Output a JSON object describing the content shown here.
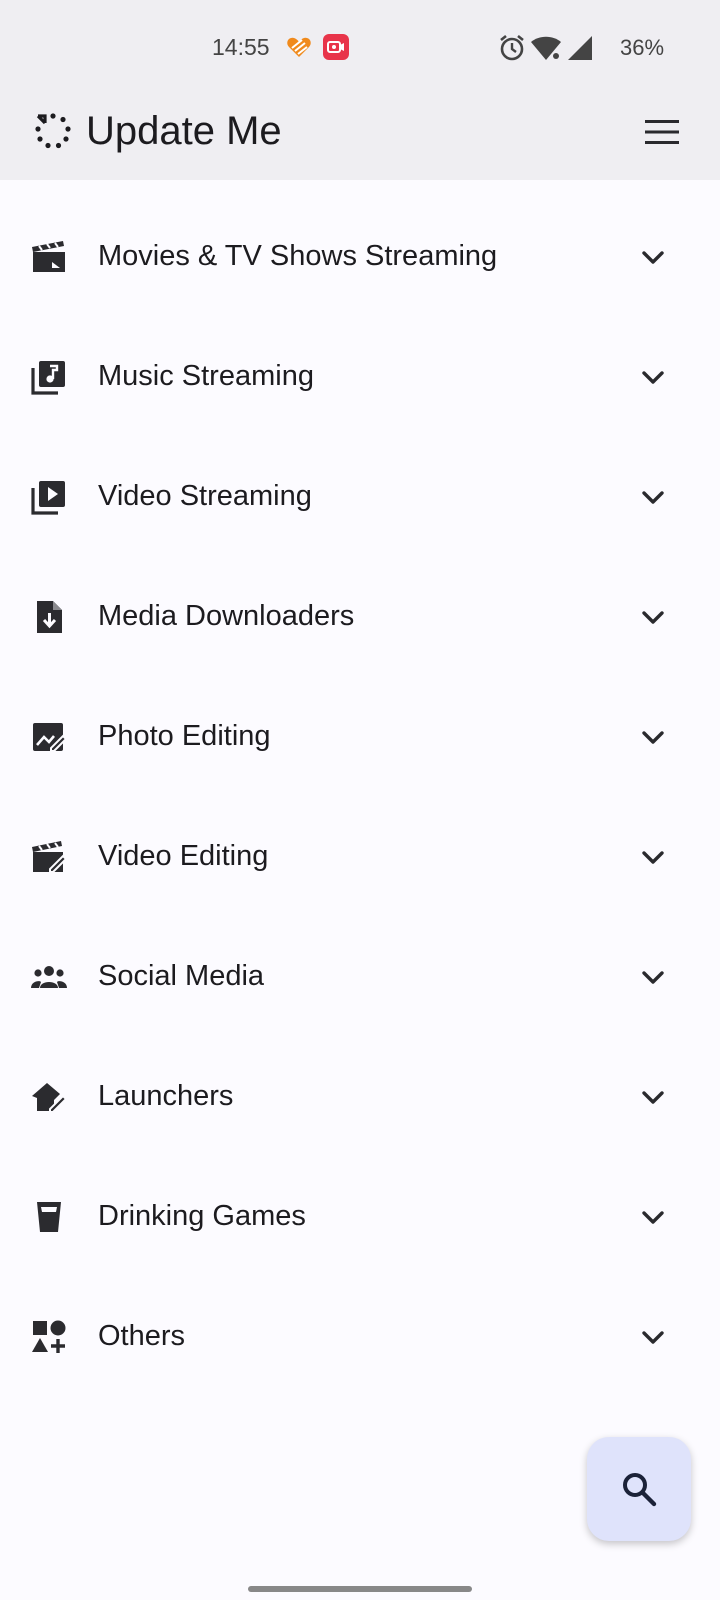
{
  "status_bar": {
    "time": "14:55",
    "battery": "36%",
    "icons": [
      "heart-app-icon",
      "screen-record-icon",
      "alarm-icon",
      "wifi-icon",
      "cell-signal-icon"
    ]
  },
  "app_bar": {
    "title": "Update Me",
    "logo_icon": "update-loop-icon",
    "menu_icon": "hamburger-menu-icon"
  },
  "categories": [
    {
      "label": "Movies & TV Shows Streaming",
      "icon": "movie-clapper-icon"
    },
    {
      "label": "Music Streaming",
      "icon": "music-library-icon"
    },
    {
      "label": "Video Streaming",
      "icon": "video-library-icon"
    },
    {
      "label": "Media Downloaders",
      "icon": "file-download-icon"
    },
    {
      "label": "Photo Editing",
      "icon": "photo-edit-icon"
    },
    {
      "label": "Video Editing",
      "icon": "video-edit-icon"
    },
    {
      "label": "Social Media",
      "icon": "group-icon"
    },
    {
      "label": "Launchers",
      "icon": "home-edit-icon"
    },
    {
      "label": "Drinking Games",
      "icon": "cup-icon"
    },
    {
      "label": "Others",
      "icon": "shapes-icon"
    }
  ],
  "fab": {
    "icon": "search-icon"
  },
  "colors": {
    "background": "#fcfbff",
    "app_bar": "#efeef2",
    "fab": "#dfe3fb",
    "text": "#1c1b1f",
    "record_badge": "#e8344a",
    "heart_app": "#f08a1c"
  }
}
